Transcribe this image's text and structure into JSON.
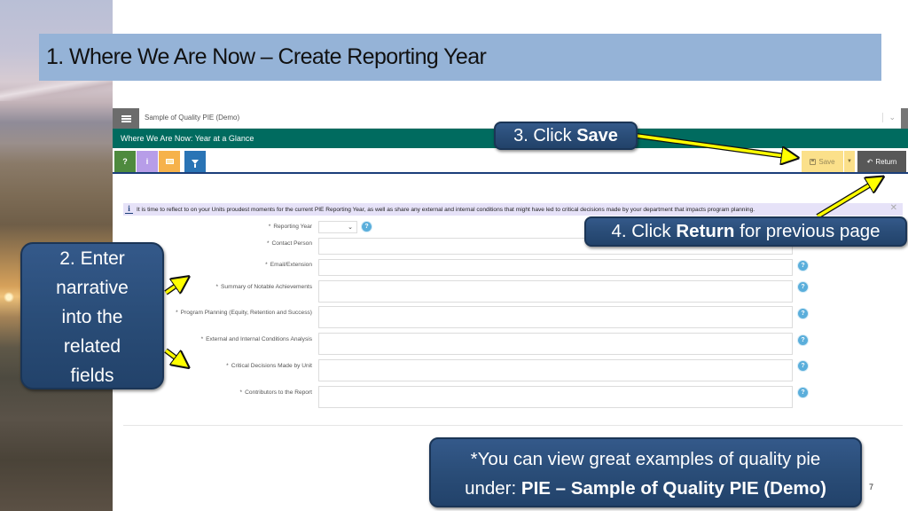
{
  "slide": {
    "title": "1. Where We Are Now – Create Reporting Year",
    "page_number": "7"
  },
  "app": {
    "name": "Sample of Quality PIE (Demo)",
    "header": "Where We Are Now: Year at a Glance",
    "toolbar": {
      "help_label": "?",
      "info_label": "i",
      "save_label": "Save",
      "return_label": "Return",
      "icons": [
        "help-icon",
        "info-icon",
        "envelope-icon",
        "filter-icon",
        "save-disk-icon",
        "caret-down-icon",
        "return-arrow-icon"
      ]
    },
    "info_message": "It is time to reflect to on your Units proudest moments for the current PIE Reporting Year, as well as share any external and internal conditions that might have led to critical decisions made by your department that impacts program planning.",
    "form": {
      "required_marker": "*",
      "help_glyph": "?",
      "reporting_year": {
        "label": "Reporting Year",
        "value": ""
      },
      "fields": [
        {
          "label": "Contact Person",
          "value": ""
        },
        {
          "label": "Email/Extension",
          "value": ""
        },
        {
          "label": "Summary of Notable Achievements",
          "value": ""
        },
        {
          "label": "Program Planning (Equity, Retention and Success)",
          "value": ""
        },
        {
          "label": "External and Internal Conditions Analysis",
          "value": ""
        },
        {
          "label": "Critical Decisions Made by Unit",
          "value": ""
        },
        {
          "label": "Contributors to the Report",
          "value": ""
        }
      ]
    }
  },
  "callouts": {
    "save": {
      "prefix": "3. Click ",
      "bold": "Save"
    },
    "return": {
      "prefix": "4. Click ",
      "bold": "Return",
      "suffix": " for previous page"
    },
    "enter": {
      "lines": [
        "2. Enter",
        "narrative",
        "into the",
        "related",
        "fields"
      ]
    },
    "examples": {
      "line1": "*You can view great examples of quality pie",
      "line2_prefix": "under: ",
      "line2_bold": "PIE – Sample of Quality PIE (Demo)"
    }
  },
  "colors": {
    "title_bar": "#95b3d7",
    "app_header": "#006b5f",
    "callout": "#2a4d78",
    "arrow": "#ffff00",
    "save_button": "#fbe08a",
    "return_button": "#585858"
  }
}
